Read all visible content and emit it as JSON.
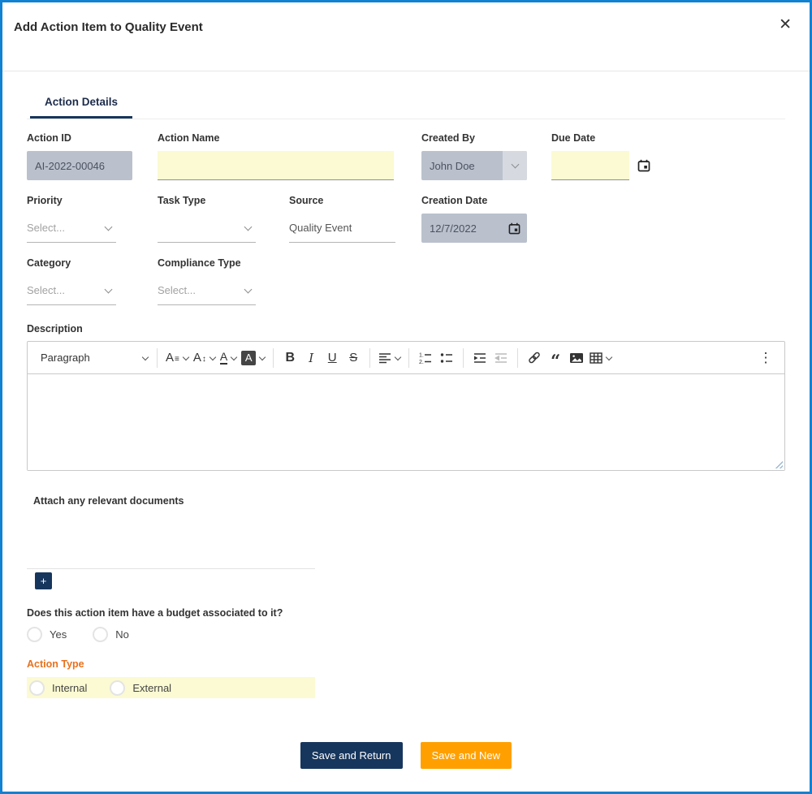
{
  "modal": {
    "title": "Add Action Item to Quality Event",
    "close_label": "✕"
  },
  "tab": {
    "label": "Action Details"
  },
  "fields": {
    "action_id": {
      "label": "Action ID",
      "value": "AI-2022-00046"
    },
    "action_name": {
      "label": "Action Name",
      "value": ""
    },
    "created_by": {
      "label": "Created By",
      "value": "John Doe"
    },
    "due_date": {
      "label": "Due Date",
      "value": ""
    },
    "priority": {
      "label": "Priority",
      "placeholder": "Select..."
    },
    "task_type": {
      "label": "Task Type",
      "placeholder": ""
    },
    "source": {
      "label": "Source",
      "value": "Quality Event"
    },
    "creation_date": {
      "label": "Creation Date",
      "value": "12/7/2022"
    },
    "category": {
      "label": "Category",
      "placeholder": "Select..."
    },
    "compliance_type": {
      "label": "Compliance Type",
      "placeholder": "Select..."
    },
    "description": {
      "label": "Description"
    }
  },
  "editor": {
    "paragraph": "Paragraph",
    "icons": {
      "font_family": "A",
      "font_family_mark": "≡",
      "font_size": "A",
      "font_size_mark": "↕",
      "font_color": "A",
      "bg_color": "A",
      "bold": "B",
      "italic": "I",
      "underline": "U",
      "strikethrough": "S",
      "quote": "“",
      "overflow": "⋮"
    }
  },
  "attachments": {
    "label": "Attach any relevant documents",
    "add_label": "+"
  },
  "budget": {
    "question": "Does this action item have a budget associated to it?",
    "yes": "Yes",
    "no": "No"
  },
  "action_type": {
    "label": "Action Type",
    "internal": "Internal",
    "external": "External"
  },
  "footer": {
    "save_return": "Save and Return",
    "save_new": "Save and New"
  },
  "colors": {
    "border_blue": "#1181d2",
    "navy": "#17365d",
    "orange_btn": "#ffa000",
    "orange_label": "#e8711c",
    "field_yellow": "#fbfad2",
    "field_gray": "#bac1cd",
    "field_gray_light": "#d6dae0"
  }
}
